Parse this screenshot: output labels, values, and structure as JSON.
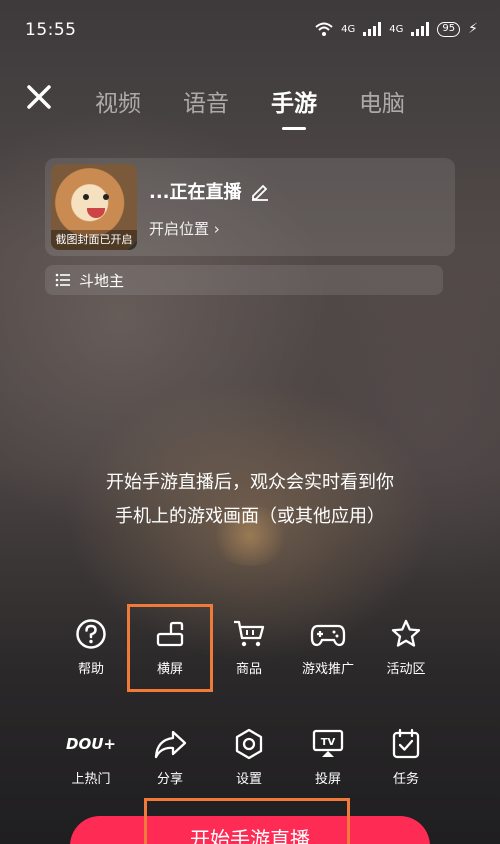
{
  "status_bar": {
    "time": "15:55",
    "battery": "95",
    "network1": "4G",
    "network2": "4G"
  },
  "header": {
    "tabs": [
      {
        "label": "视频",
        "active": false
      },
      {
        "label": "语音",
        "active": false
      },
      {
        "label": "手游",
        "active": true
      },
      {
        "label": "电脑",
        "active": false
      }
    ]
  },
  "live_card": {
    "cover_label": "截图封面已开启",
    "title": "...正在直播",
    "location": "开启位置"
  },
  "category": {
    "label": "斗地主"
  },
  "description": {
    "line1": "开始手游直播后，观众会实时看到你",
    "line2": "手机上的游戏画面（或其他应用）"
  },
  "tools_row1": [
    {
      "label": "帮助",
      "icon": "help-icon"
    },
    {
      "label": "横屏",
      "icon": "landscape-icon"
    },
    {
      "label": "商品",
      "icon": "cart-icon"
    },
    {
      "label": "游戏推广",
      "icon": "gamepad-icon"
    },
    {
      "label": "活动区",
      "icon": "star-icon"
    }
  ],
  "tools_row2": [
    {
      "label": "上热门",
      "icon": "dou-plus-icon",
      "brand": "DOU+"
    },
    {
      "label": "分享",
      "icon": "share-icon"
    },
    {
      "label": "设置",
      "icon": "settings-icon"
    },
    {
      "label": "投屏",
      "icon": "cast-icon"
    },
    {
      "label": "任务",
      "icon": "task-icon"
    }
  ],
  "start_button": {
    "label": "开始手游直播"
  },
  "colors": {
    "accent": "#fe2c55",
    "highlight": "#f07a3a"
  }
}
